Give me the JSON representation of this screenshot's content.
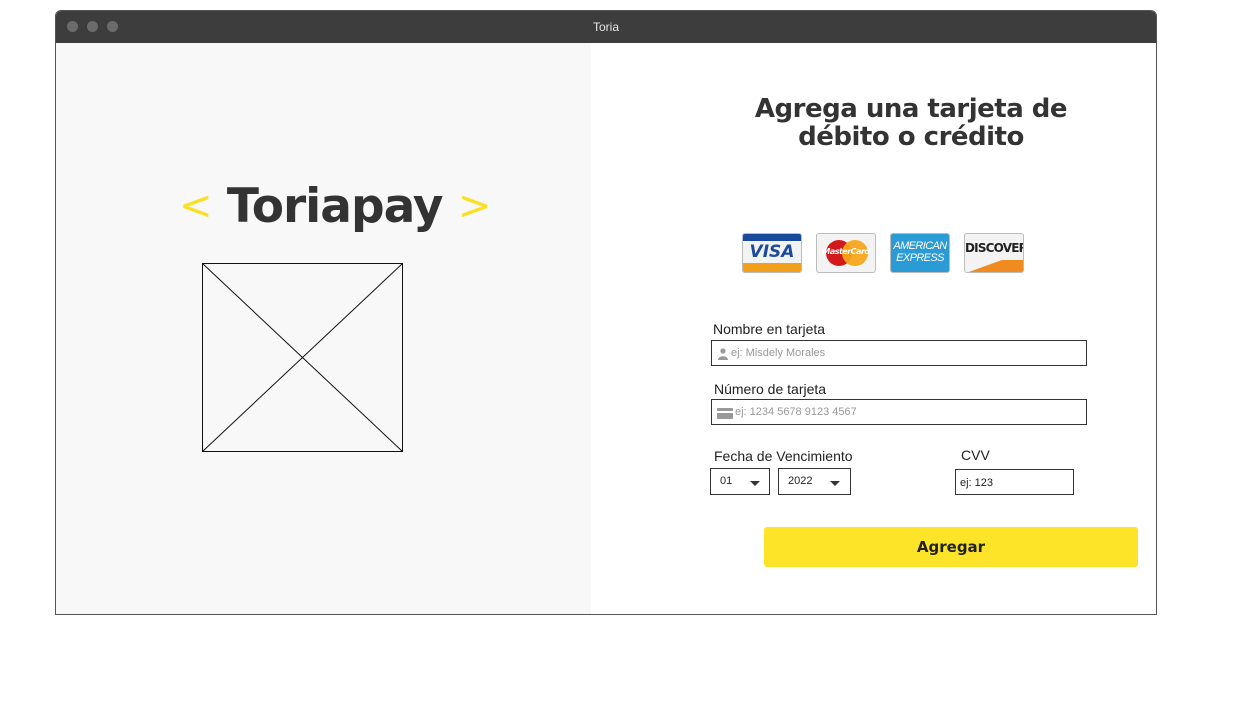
{
  "window": {
    "title": "Toria"
  },
  "brand": {
    "open_bracket": "<",
    "name": "Toriapay",
    "close_bracket": ">"
  },
  "form": {
    "heading": "Agrega una tarjeta de débito o crédito",
    "cards": [
      {
        "name": "VISA"
      },
      {
        "name": "MasterCard"
      },
      {
        "name": "AMERICAN",
        "line2": "EXPRESS"
      },
      {
        "name": "DISCOVER"
      }
    ],
    "name_label": "Nombre en tarjeta",
    "name_placeholder": "ej: Misdely Morales",
    "number_label": "Número de tarjeta",
    "number_placeholder": "ej: 1234 5678 9123 4567",
    "expiry_label": "Fecha de Vencimiento",
    "month_value": "01",
    "year_value": "2022",
    "cvv_label": "CVV",
    "cvv_value": "ej: 123",
    "submit_label": "Agregar"
  },
  "colors": {
    "accent": "#fde428",
    "titlebar": "#3d3d3d",
    "left_panel": "#f8f8f8"
  }
}
